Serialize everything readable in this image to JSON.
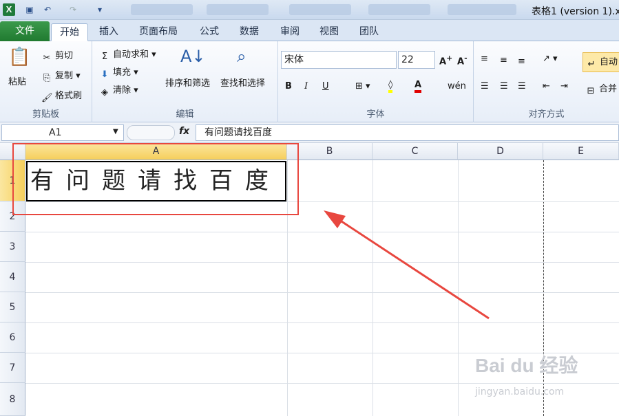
{
  "window": {
    "title": "表格1 (version 1).x"
  },
  "ribbon_tabs": [
    "文件",
    "开始",
    "插入",
    "页面布局",
    "公式",
    "数据",
    "审阅",
    "视图",
    "团队"
  ],
  "clipboard": {
    "paste": "粘贴",
    "cut": "剪切",
    "copy": "复制",
    "painter": "格式刷",
    "label": "剪贴板"
  },
  "editing": {
    "autosum": "自动求和",
    "fill": "填充",
    "clear": "清除",
    "sort": "排序和筛选",
    "find": "查找和选择",
    "label": "编辑"
  },
  "font": {
    "name": "宋体",
    "size": "22",
    "label": "字体",
    "bold": "B",
    "italic": "I",
    "underline": "U",
    "wen": "wén"
  },
  "alignment": {
    "label": "对齐方式",
    "wrap": "自动",
    "merge": "合并"
  },
  "formula_bar": {
    "name_box": "A1",
    "fx": "fx",
    "content": "有问题请找百度"
  },
  "columns": [
    "A",
    "B",
    "C",
    "D",
    "E"
  ],
  "rows": [
    "1",
    "2",
    "3",
    "4",
    "5",
    "6",
    "7",
    "8"
  ],
  "cells": {
    "A1": "有问题请找百度"
  },
  "watermark": {
    "text": "Bai du 经验",
    "url": "jingyan.baidu.com"
  },
  "colors": {
    "file_tab": "#207a30",
    "annotation": "#e8473f",
    "fill_yellow": "#ffff00",
    "font_red": "#e00000"
  }
}
